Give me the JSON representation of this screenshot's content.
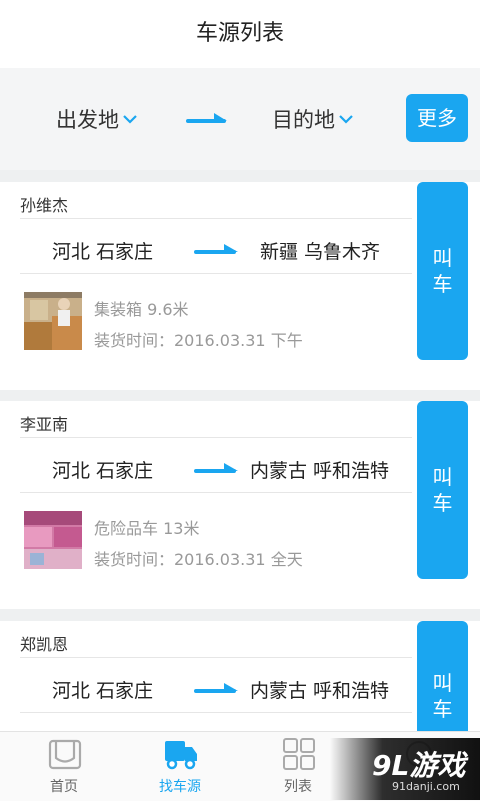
{
  "header": {
    "title": "车源列表"
  },
  "filter": {
    "origin_label": "出发地",
    "destination_label": "目的地",
    "more_label": "更多"
  },
  "colors": {
    "accent": "#1aa6f0",
    "background": "#eef0f1"
  },
  "cards": [
    {
      "name": "孙维杰",
      "from": "河北 石家庄",
      "to": "新疆 乌鲁木齐",
      "vehicle": "集装箱 9.6米",
      "load_time": "装货时间：2016.03.31 下午",
      "call_label_1": "叫",
      "call_label_2": "车"
    },
    {
      "name": "李亚南",
      "from": "河北 石家庄",
      "to": "内蒙古 呼和浩特",
      "vehicle": "危险品车 13米",
      "load_time": "装货时间：2016.03.31 全天",
      "call_label_1": "叫",
      "call_label_2": "车"
    },
    {
      "name": "郑凯恩",
      "from": "河北 石家庄",
      "to": "内蒙古 呼和浩特",
      "call_label_1": "叫",
      "call_label_2": "车"
    }
  ],
  "tabs": [
    {
      "label": "首页",
      "icon": "home-icon"
    },
    {
      "label": "找车源",
      "icon": "truck-icon",
      "active": true
    },
    {
      "label": "列表",
      "icon": "grid-icon"
    },
    {
      "label": "",
      "icon": "settings-icon"
    }
  ],
  "watermark": {
    "brand": "9L游戏",
    "url": "91danji.com"
  }
}
